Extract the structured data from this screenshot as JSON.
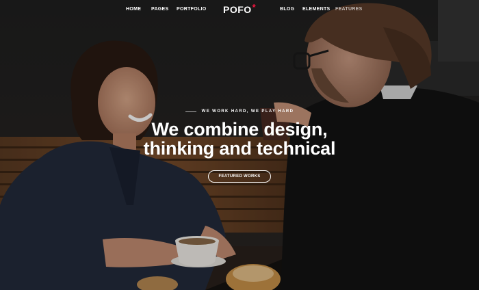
{
  "header": {
    "logo": "POFO",
    "logo_mark": "*",
    "brand_color": "#f4153f",
    "nav_left": [
      "HOME",
      "PAGES",
      "PORTFOLIO"
    ],
    "nav_right": [
      "BLOG",
      "ELEMENTS",
      "FEATURES"
    ]
  },
  "hero": {
    "tagline": "WE WORK HARD, WE PLAY HARD",
    "headline_line1": "We combine design,",
    "headline_line2": "thinking and technical",
    "cta_label": "FEATURED WORKS"
  }
}
